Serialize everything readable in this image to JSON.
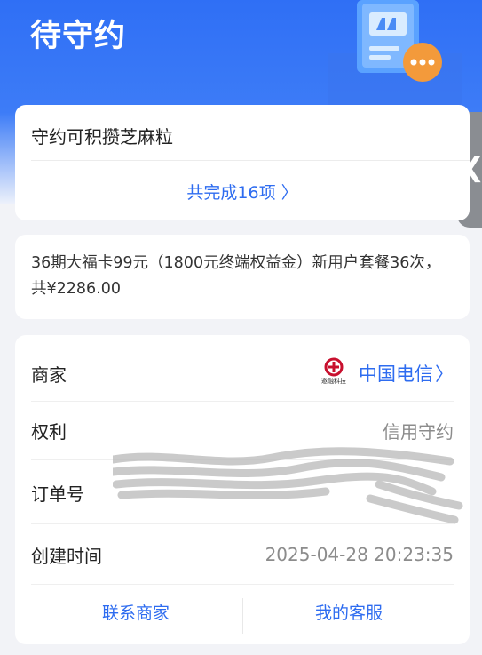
{
  "header": {
    "title": "待守约"
  },
  "side_handle": {
    "icon": "chevron-left-icon"
  },
  "summary_card": {
    "title": "守约可积攒芝麻粒",
    "link_label": "共完成16项 〉"
  },
  "description": {
    "text": "36期大福卡99元（1800元终端权益金）新用户套餐36次，共¥2286.00"
  },
  "details": {
    "merchant_label": "商家",
    "merchant_logo_caption": "邀融科技",
    "merchant_name": "中国电信",
    "merchant_chevron": "〉",
    "rights_label": "权利",
    "rights_value": "信用守约",
    "order_label": "订单号",
    "created_label": "创建时间",
    "created_value": "2025-04-28 20:23:35"
  },
  "actions": {
    "contact_merchant": "联系商家",
    "my_service": "我的客服"
  },
  "colors": {
    "brand_blue": "#2e6cf0",
    "hero_blue": "#2f6ff5",
    "muted": "#8c8c8c"
  }
}
